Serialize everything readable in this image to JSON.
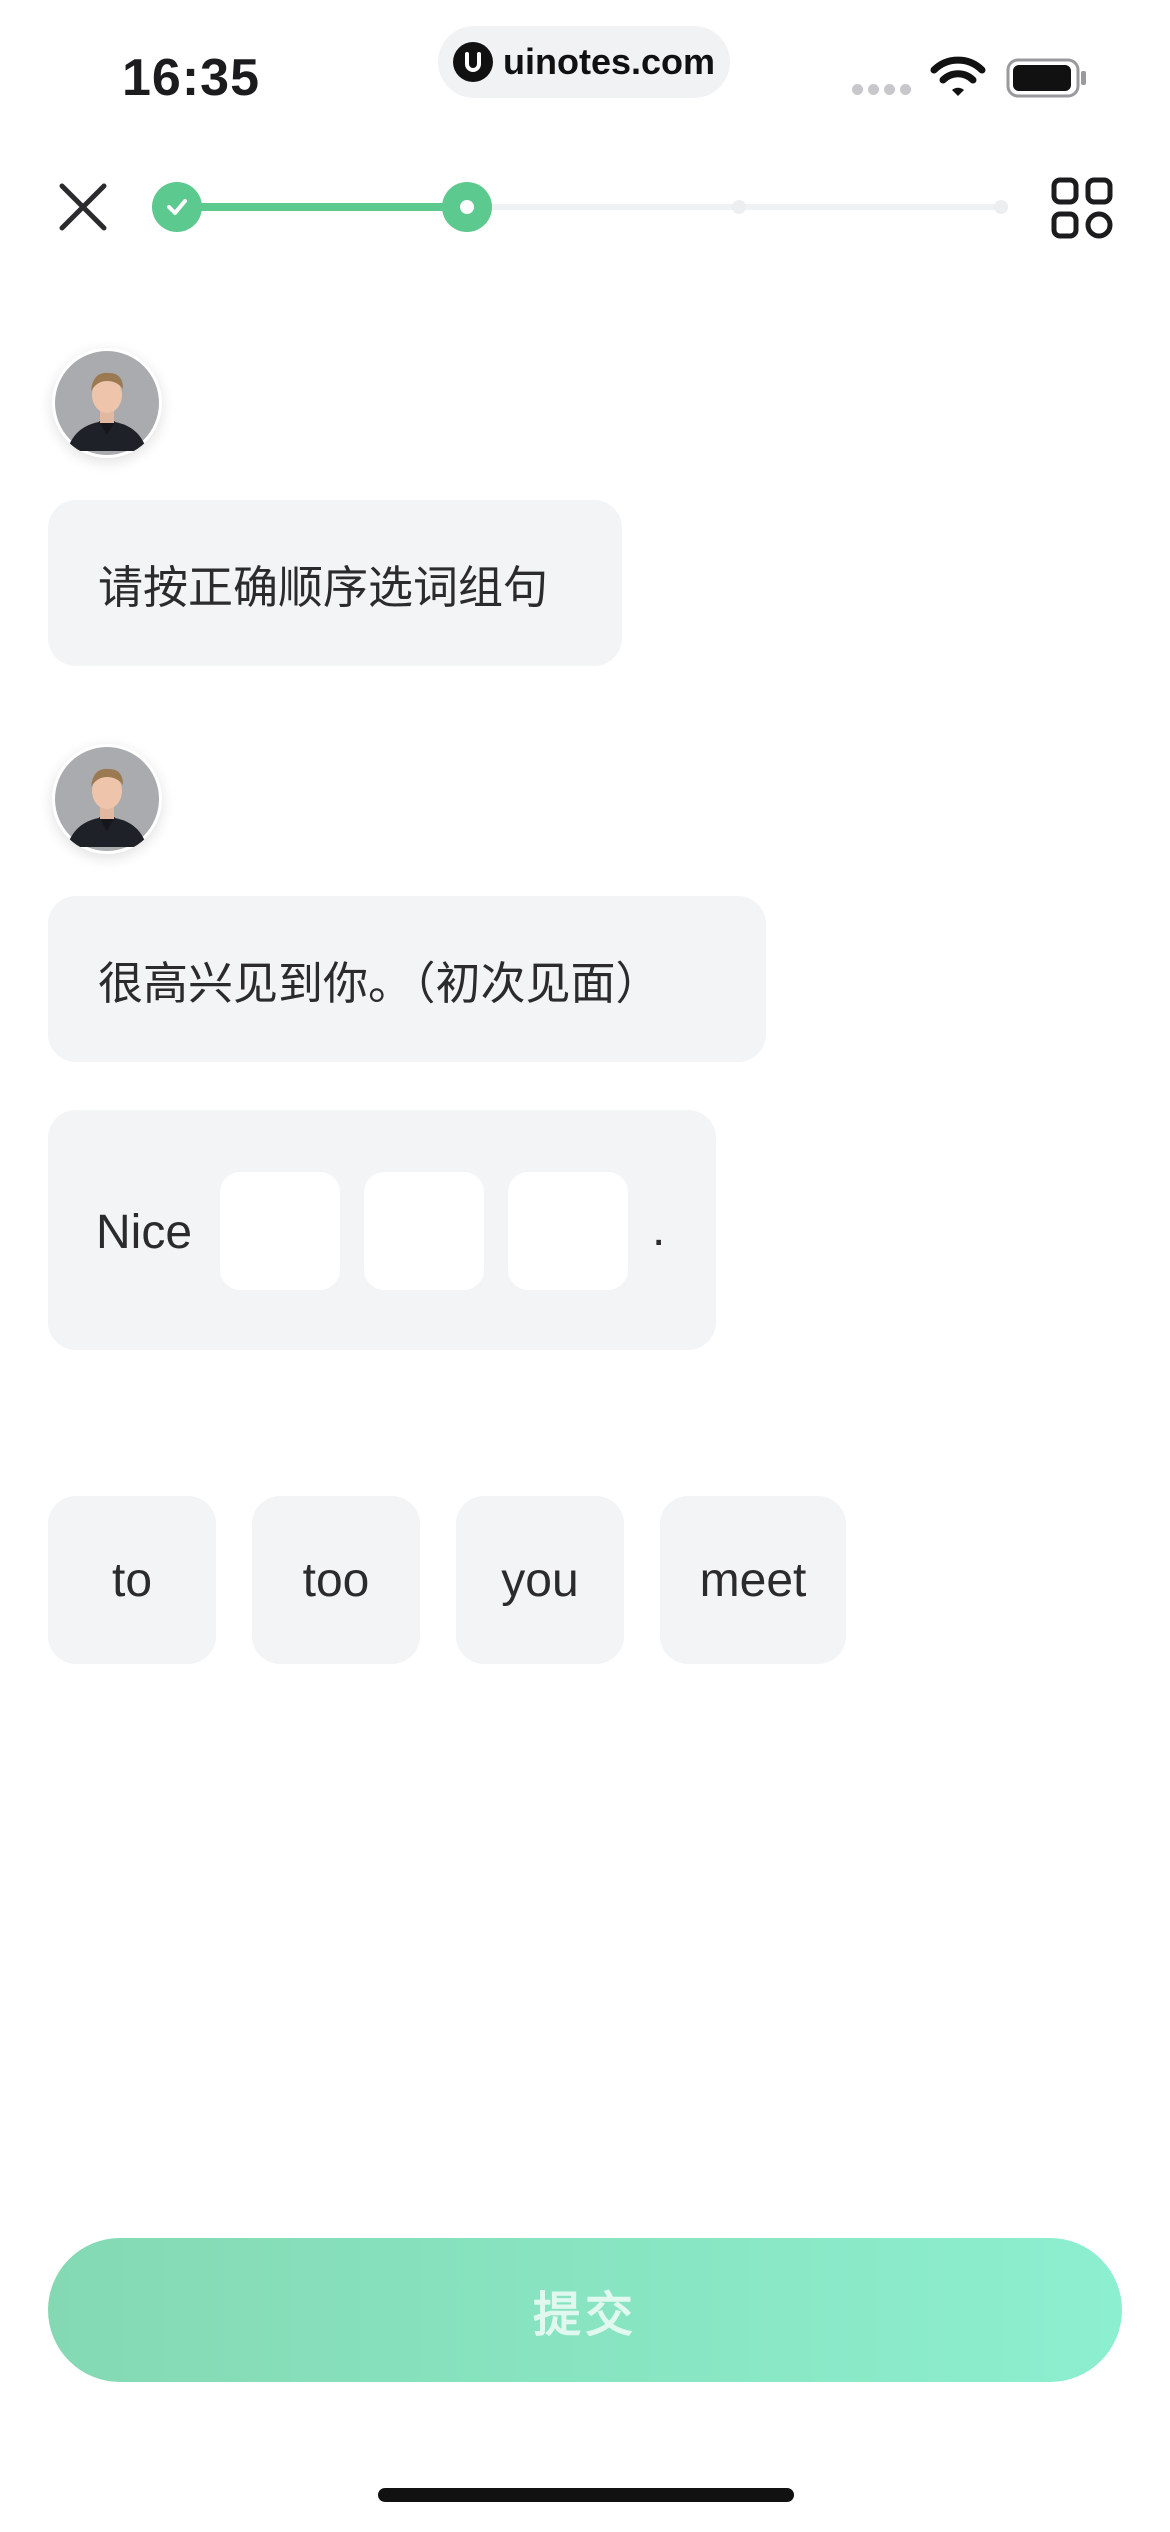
{
  "status_bar": {
    "time": "16:35",
    "watermark": "uinotes.com"
  },
  "progress": {
    "fraction_completed": 0.35,
    "steps_total": 4,
    "current_step": 2,
    "accent_color": "#5cc98e"
  },
  "chat": {
    "instruction": "请按正确顺序选词组句",
    "prompt_sentence": "很高兴见到你。（初次见面）"
  },
  "answer": {
    "prefix": "Nice",
    "blank_count": 3,
    "suffix": "."
  },
  "word_options": [
    "to",
    "too",
    "you",
    "meet"
  ],
  "submit_label": "提交",
  "icons": {
    "close": "close-icon",
    "grid": "grid-icon",
    "check": "check-icon",
    "avatar": "avatar-icon"
  }
}
